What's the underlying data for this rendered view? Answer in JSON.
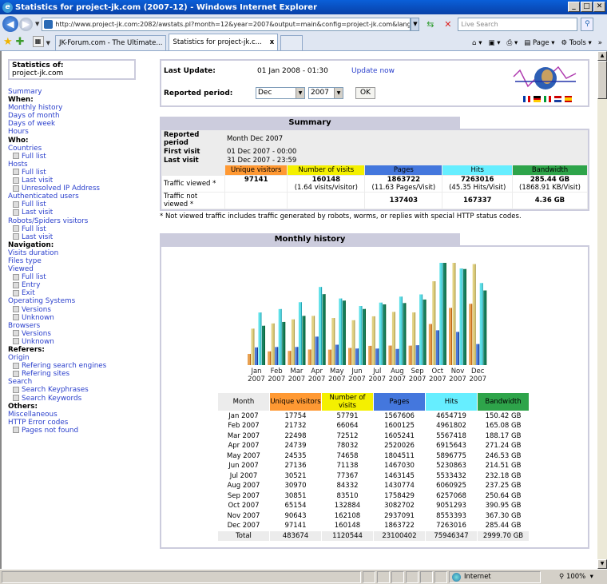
{
  "window": {
    "title": "Statistics for project-jk.com (2007-12) - Windows Internet Explorer",
    "url": "http://www.project-jk.com:2082/awstats.pl?month=12&year=2007&output=main&config=project-jk.com&lang=en",
    "search_placeholder": "Live Search",
    "tabs": [
      {
        "label": "JK-Forum.com - The Ultimate...",
        "active": false
      },
      {
        "label": "Statistics for project-jk.c...",
        "active": true
      }
    ],
    "tools": {
      "page": "Page",
      "tools": "Tools"
    },
    "status": {
      "zone": "Internet",
      "zoom": "100%"
    }
  },
  "sidebar": {
    "stat_label": "Statistics of:",
    "site": "project-jk.com",
    "items": [
      {
        "label": "Summary",
        "type": "link"
      },
      {
        "label": "When:",
        "type": "heading"
      },
      {
        "label": "Monthly history",
        "type": "link"
      },
      {
        "label": "Days of month",
        "type": "link"
      },
      {
        "label": "Days of week",
        "type": "link"
      },
      {
        "label": "Hours",
        "type": "link"
      },
      {
        "label": "Who:",
        "type": "heading"
      },
      {
        "label": "Countries",
        "type": "link"
      },
      {
        "label": "Full list",
        "type": "sub"
      },
      {
        "label": "Hosts",
        "type": "link"
      },
      {
        "label": "Full list",
        "type": "sub"
      },
      {
        "label": "Last visit",
        "type": "sub"
      },
      {
        "label": "Unresolved IP Address",
        "type": "sub"
      },
      {
        "label": "Authenticated users",
        "type": "link"
      },
      {
        "label": "Full list",
        "type": "sub"
      },
      {
        "label": "Last visit",
        "type": "sub"
      },
      {
        "label": "Robots/Spiders visitors",
        "type": "link"
      },
      {
        "label": "Full list",
        "type": "sub"
      },
      {
        "label": "Last visit",
        "type": "sub"
      },
      {
        "label": "Navigation:",
        "type": "heading"
      },
      {
        "label": "Visits duration",
        "type": "link"
      },
      {
        "label": "Files type",
        "type": "link"
      },
      {
        "label": "Viewed",
        "type": "link"
      },
      {
        "label": "Full list",
        "type": "sub"
      },
      {
        "label": "Entry",
        "type": "sub"
      },
      {
        "label": "Exit",
        "type": "sub"
      },
      {
        "label": "Operating Systems",
        "type": "link"
      },
      {
        "label": "Versions",
        "type": "sub"
      },
      {
        "label": "Unknown",
        "type": "sub"
      },
      {
        "label": "Browsers",
        "type": "link"
      },
      {
        "label": "Versions",
        "type": "sub"
      },
      {
        "label": "Unknown",
        "type": "sub"
      },
      {
        "label": "Referers:",
        "type": "heading"
      },
      {
        "label": "Origin",
        "type": "link"
      },
      {
        "label": "Refering search engines",
        "type": "sub"
      },
      {
        "label": "Refering sites",
        "type": "sub"
      },
      {
        "label": "Search",
        "type": "link"
      },
      {
        "label": "Search Keyphrases",
        "type": "sub"
      },
      {
        "label": "Search Keywords",
        "type": "sub"
      },
      {
        "label": "Others:",
        "type": "heading"
      },
      {
        "label": "Miscellaneous",
        "type": "link"
      },
      {
        "label": "HTTP Error codes",
        "type": "link"
      },
      {
        "label": "Pages not found",
        "type": "sub"
      }
    ]
  },
  "info": {
    "last_update_label": "Last Update:",
    "last_update": "01 Jan 2008 - 01:30",
    "update_now": "Update now",
    "period_label": "Reported period:",
    "month": "Dec",
    "year": "2007",
    "ok": "OK"
  },
  "summary": {
    "title": "Summary",
    "reported_period_label": "Reported period",
    "reported_period": "Month Dec 2007",
    "first_visit_label": "First visit",
    "first_visit": "01 Dec 2007 - 00:00",
    "last_visit_label": "Last visit",
    "last_visit": "31 Dec 2007 - 23:59",
    "headers": [
      "Unique visitors",
      "Number of visits",
      "Pages",
      "Hits",
      "Bandwidth"
    ],
    "viewed_label": "Traffic viewed *",
    "viewed": [
      "97141",
      "160148",
      "1863722",
      "7263016",
      "285.44 GB"
    ],
    "viewed_sub": [
      "",
      "(1.64 visits/visitor)",
      "(11.63 Pages/Visit)",
      "(45.35 Hits/Visit)",
      "(1868.91 KB/Visit)"
    ],
    "not_viewed_label": "Traffic not viewed *",
    "not_viewed": [
      "",
      "",
      "137403",
      "167337",
      "4.36 GB"
    ],
    "note": "* Not viewed traffic includes traffic generated by robots, worms, or replies with special HTTP status codes."
  },
  "history": {
    "title": "Monthly history",
    "headers": [
      "Month",
      "Unique visitors",
      "Number of visits",
      "Pages",
      "Hits",
      "Bandwidth"
    ],
    "rows": [
      [
        "Jan 2007",
        "17754",
        "57791",
        "1567606",
        "4654719",
        "150.42 GB"
      ],
      [
        "Feb 2007",
        "21732",
        "66064",
        "1600125",
        "4961802",
        "165.08 GB"
      ],
      [
        "Mar 2007",
        "22498",
        "72512",
        "1605241",
        "5567418",
        "188.17 GB"
      ],
      [
        "Apr 2007",
        "24739",
        "78032",
        "2520026",
        "6915643",
        "271.24 GB"
      ],
      [
        "May 2007",
        "24535",
        "74658",
        "1804511",
        "5896775",
        "246.53 GB"
      ],
      [
        "Jun 2007",
        "27136",
        "71138",
        "1467030",
        "5230863",
        "214.51 GB"
      ],
      [
        "Jul 2007",
        "30521",
        "77367",
        "1463145",
        "5533432",
        "232.18 GB"
      ],
      [
        "Aug 2007",
        "30970",
        "84332",
        "1430774",
        "6060925",
        "237.25 GB"
      ],
      [
        "Sep 2007",
        "30851",
        "83510",
        "1758429",
        "6257068",
        "250.64 GB"
      ],
      [
        "Oct 2007",
        "65154",
        "132884",
        "3082702",
        "9051293",
        "390.95 GB"
      ],
      [
        "Nov 2007",
        "90643",
        "162108",
        "2937091",
        "8553393",
        "367.30 GB"
      ],
      [
        "Dec 2007",
        "97141",
        "160148",
        "1863722",
        "7263016",
        "285.44 GB"
      ]
    ],
    "total": [
      "Total",
      "483674",
      "1120544",
      "23100402",
      "75946347",
      "2999.70 GB"
    ]
  },
  "chart_data": {
    "type": "bar",
    "title": "Monthly history",
    "categories": [
      "Jan 2007",
      "Feb 2007",
      "Mar 2007",
      "Apr 2007",
      "May 2007",
      "Jun 2007",
      "Jul 2007",
      "Aug 2007",
      "Sep 2007",
      "Oct 2007",
      "Nov 2007",
      "Dec 2007"
    ],
    "series": [
      {
        "name": "Unique visitors",
        "color": "#ff9933",
        "scale_group": "visits",
        "values": [
          17754,
          21732,
          22498,
          24739,
          24535,
          27136,
          30521,
          30970,
          30851,
          65154,
          90643,
          97141
        ]
      },
      {
        "name": "Number of visits",
        "color": "#e8d88a",
        "scale_group": "visits",
        "values": [
          57791,
          66064,
          72512,
          78032,
          74658,
          71138,
          77367,
          84332,
          83510,
          132884,
          162108,
          160148
        ]
      },
      {
        "name": "Pages",
        "color": "#4477dd",
        "scale_group": "hits",
        "values": [
          1567606,
          1600125,
          1605241,
          2520026,
          1804511,
          1467030,
          1463145,
          1430774,
          1758429,
          3082702,
          2937091,
          1863722
        ]
      },
      {
        "name": "Hits",
        "color": "#66eeff",
        "scale_group": "hits",
        "values": [
          4654719,
          4961802,
          5567418,
          6915643,
          5896775,
          5230863,
          5533432,
          6060925,
          6257068,
          9051293,
          8553393,
          7263016
        ]
      },
      {
        "name": "Bandwidth",
        "color": "#2ea44a",
        "scale_group": "bw",
        "values": [
          150.42,
          165.08,
          188.17,
          271.24,
          246.53,
          214.51,
          232.18,
          237.25,
          250.64,
          390.95,
          367.3,
          285.44
        ]
      }
    ],
    "xlabel": "",
    "ylabel": "",
    "grid": false,
    "legend": "none"
  },
  "colors": {
    "uv": "#ff9933",
    "nv": "#f4f000",
    "pg": "#4477dd",
    "hi": "#66eeff",
    "bw": "#2ea44a",
    "link": "#2a3fcc"
  }
}
